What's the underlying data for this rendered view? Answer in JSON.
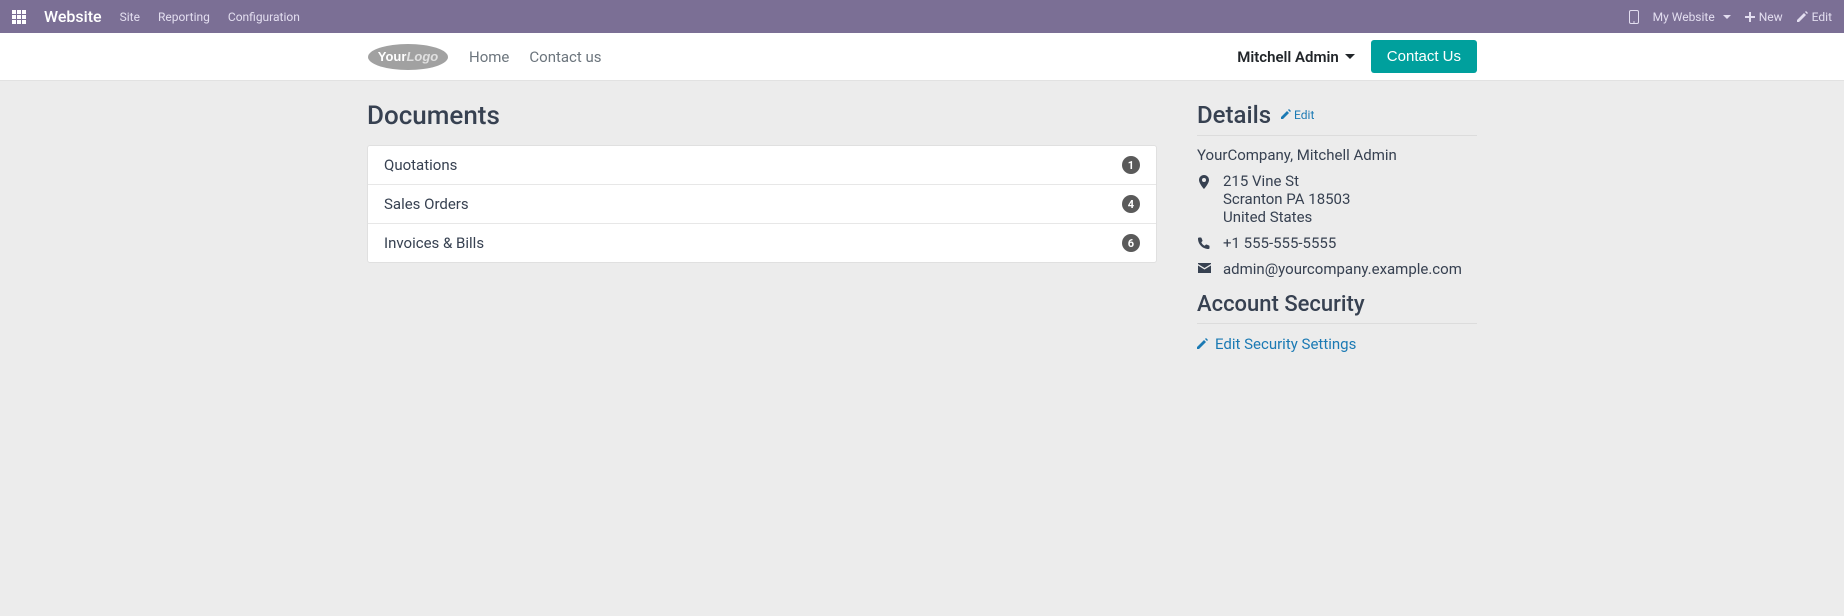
{
  "topbar": {
    "brand": "Website",
    "nav": [
      {
        "label": "Site"
      },
      {
        "label": "Reporting"
      },
      {
        "label": "Configuration"
      }
    ],
    "my_website": "My Website",
    "new": "New",
    "edit": "Edit"
  },
  "navbar": {
    "links": [
      {
        "label": "Home"
      },
      {
        "label": "Contact us"
      }
    ],
    "user_name": "Mitchell Admin",
    "contact_btn": "Contact Us"
  },
  "documents": {
    "title": "Documents",
    "rows": [
      {
        "label": "Quotations",
        "count": "1"
      },
      {
        "label": "Sales Orders",
        "count": "4"
      },
      {
        "label": "Invoices & Bills",
        "count": "6"
      }
    ]
  },
  "details": {
    "title": "Details",
    "edit_label": "Edit",
    "company_line": "YourCompany, Mitchell Admin",
    "address_line1": "215 Vine St",
    "address_line2": "Scranton PA 18503",
    "address_line3": "United States",
    "phone": "+1 555-555-5555",
    "email": "admin@yourcompany.example.com"
  },
  "security": {
    "title": "Account Security",
    "edit_link": "Edit Security Settings"
  }
}
